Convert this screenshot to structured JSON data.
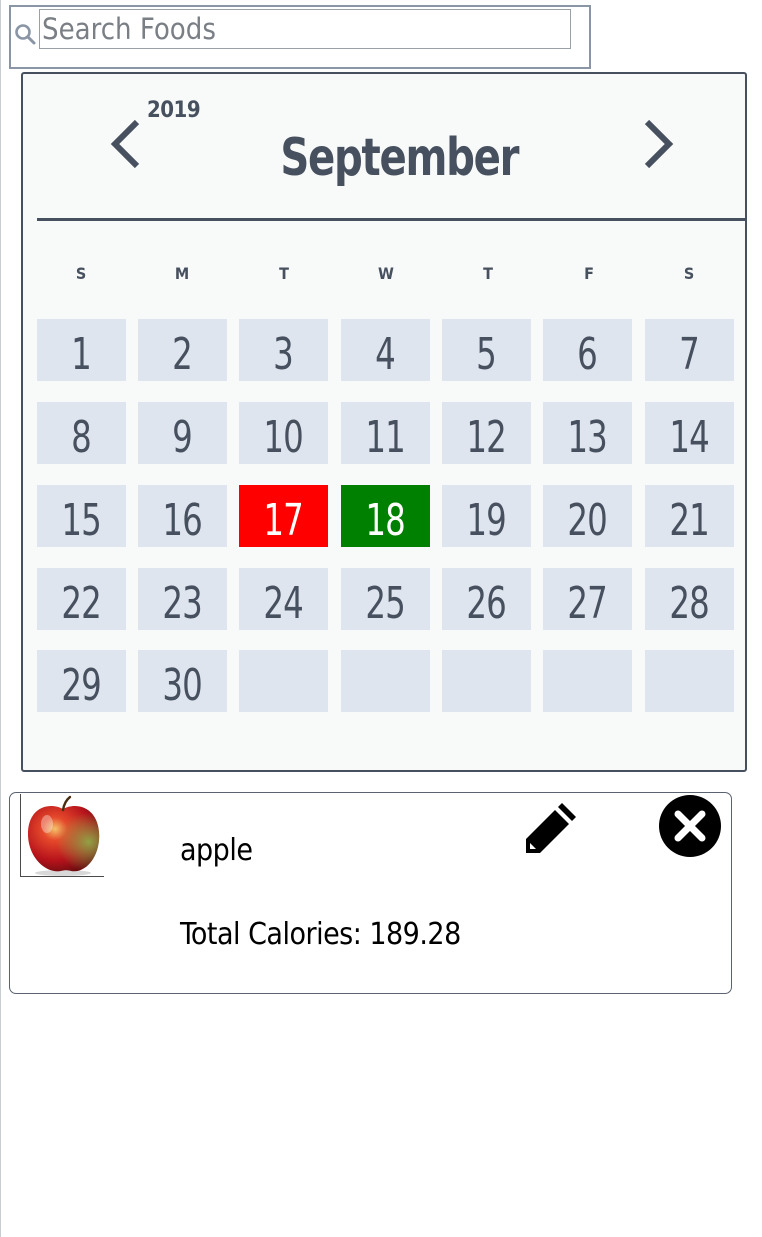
{
  "search": {
    "placeholder": "Search Foods",
    "value": "",
    "icon": "search-icon"
  },
  "calendar": {
    "year": "2019",
    "month": "September",
    "prev_icon": "chevron-left-icon",
    "next_icon": "chevron-right-icon",
    "weekdays": [
      "S",
      "M",
      "T",
      "W",
      "T",
      "F",
      "S"
    ],
    "weeks": [
      [
        "1",
        "2",
        "3",
        "4",
        "5",
        "6",
        "7"
      ],
      [
        "8",
        "9",
        "10",
        "11",
        "12",
        "13",
        "14"
      ],
      [
        "15",
        "16",
        "17",
        "18",
        "19",
        "20",
        "21"
      ],
      [
        "22",
        "23",
        "24",
        "25",
        "26",
        "27",
        "28"
      ],
      [
        "29",
        "30",
        "",
        "",
        "",
        "",
        ""
      ]
    ],
    "highlighted": [
      {
        "day": "17",
        "status": "red",
        "color": "#ff0000"
      },
      {
        "day": "18",
        "status": "green",
        "color": "#008000"
      }
    ],
    "colors": {
      "text": "#47505f",
      "cell": "#dfe5ee",
      "background": "#f8faf9"
    }
  },
  "food_entry": {
    "name": "apple",
    "calories_label": "Total Calories:",
    "calories_value": "189.28",
    "image": "apple-image",
    "edit_icon": "pencil-icon",
    "delete_icon": "close-circle-icon"
  }
}
